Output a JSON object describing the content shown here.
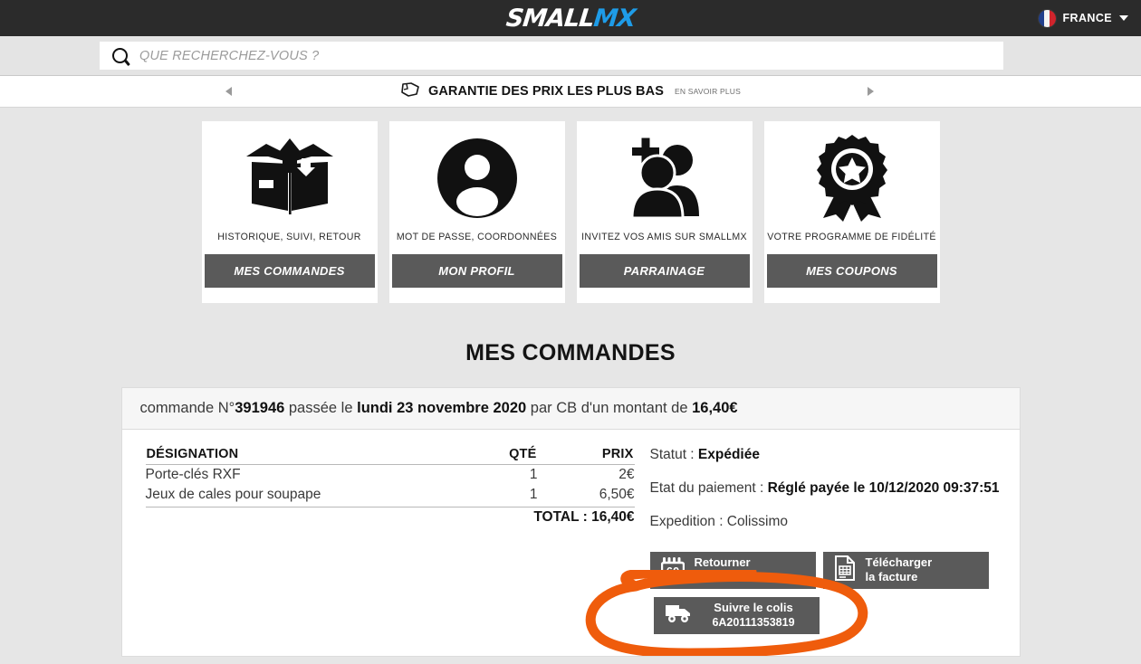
{
  "header": {
    "logo_small": "SMALL",
    "logo_mx": "MX",
    "language": "FRANCE",
    "flag_icon": "france-flag-icon",
    "caret_icon": "chevron-down-icon"
  },
  "search": {
    "placeholder": "QUE RECHERCHEZ-VOUS ?",
    "value": "",
    "icon": "search-icon"
  },
  "promo": {
    "icon": "tag-icon",
    "title": "GARANTIE DES PRIX LES PLUS BAS",
    "subtitle": "EN SAVOIR PLUS",
    "prev_icon": "arrow-left-icon",
    "next_icon": "arrow-right-icon"
  },
  "cards": [
    {
      "icon": "open-box-icon",
      "subtitle": "HISTORIQUE, SUIVI, RETOUR",
      "button": "MES COMMANDES"
    },
    {
      "icon": "user-circle-icon",
      "subtitle": "MOT DE PASSE, COORDONNÉES",
      "button": "MON PROFIL"
    },
    {
      "icon": "add-people-icon",
      "subtitle": "INVITEZ VOS AMIS SUR SMALLMX",
      "button": "PARRAINAGE"
    },
    {
      "icon": "award-medal-icon",
      "subtitle": "VOTRE PROGRAMME DE FIDÉLITÉ",
      "button": "MES COUPONS"
    }
  ],
  "page": {
    "title": "MES COMMANDES"
  },
  "order": {
    "head_prefix": "commande N°",
    "number": "391946",
    "head_mid1": " passée le ",
    "date": "lundi 23 novembre 2020",
    "head_mid2": " par CB d'un montant de ",
    "amount": "16,40€",
    "table": {
      "columns": [
        "DÉSIGNATION",
        "QTÉ",
        "PRIX"
      ],
      "rows": [
        {
          "designation": "Porte-clés RXF",
          "qty": "1",
          "price": "2€"
        },
        {
          "designation": "Jeux de cales pour soupape",
          "qty": "1",
          "price": "6,50€"
        }
      ],
      "total_label": "TOTAL : 16,40€"
    },
    "status_label": "Statut : ",
    "status_value": "Expédiée",
    "payment_label": "Etat du paiement : ",
    "payment_value": "Réglé payée le 10/12/2020 09:37:51",
    "shipping_line": "Expedition : Colissimo",
    "buttons": {
      "return": {
        "icon": "calendar-60-icon",
        "line1": "Retourner",
        "line2": "un articles"
      },
      "invoice": {
        "icon": "document-icon",
        "line1": "Télécharger",
        "line2": "la facture"
      },
      "track": {
        "icon": "truck-icon",
        "line1": "Suivre le colis",
        "tracking_number": "6A20111353819"
      }
    }
  },
  "annotation": {
    "shape": "hand-drawn-ellipse",
    "color": "#ef5c0c"
  },
  "colors": {
    "topbar": "#2b2b2b",
    "page_bg": "#e6e6e6",
    "button_gray": "#5a5a5a",
    "logo_blue": "#1e9ce8",
    "annotation_orange": "#ef5c0c"
  }
}
